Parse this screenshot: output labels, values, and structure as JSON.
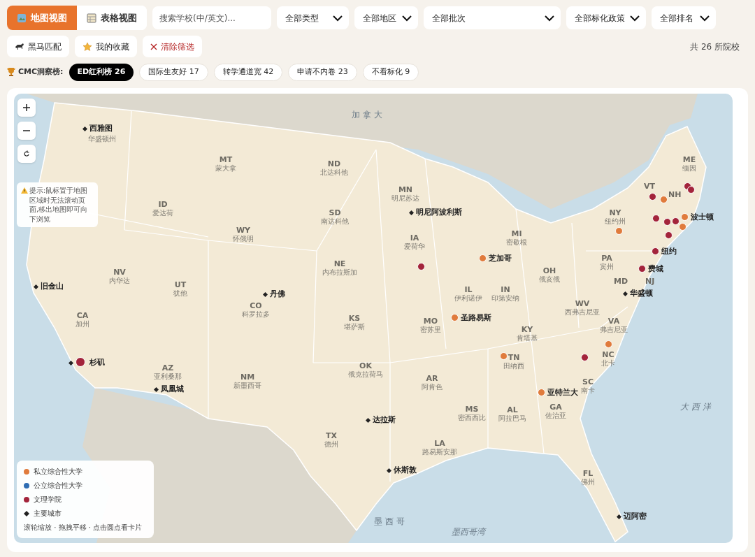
{
  "view_toggle": [
    {
      "label": "地图视图",
      "selected": true
    },
    {
      "label": "表格视图",
      "selected": false
    }
  ],
  "search": {
    "placeholder": "搜索学校(中/英文)..."
  },
  "filters": [
    "全部类型",
    "全部地区",
    "全部批次",
    "全部标化政策",
    "全部排名"
  ],
  "actions": [
    {
      "label": "黑马匹配",
      "kind": "horse"
    },
    {
      "label": "我的收藏",
      "kind": "star"
    },
    {
      "label": "清除筛选",
      "kind": "clear"
    }
  ],
  "result_count": "共 26 所院校",
  "ranking": {
    "label": "CMC洞察榜:",
    "chips": [
      {
        "label": "ED红利榜 26",
        "selected": true
      },
      {
        "label": "国际生友好 17",
        "selected": false
      },
      {
        "label": "转学通道宽 42",
        "selected": false
      },
      {
        "label": "申请不内卷 23",
        "selected": false
      },
      {
        "label": "不看标化 9",
        "selected": false
      }
    ]
  },
  "map": {
    "tip": "提示:鼠标置于地图区域时无法滚动页面,移出地图即可向下浏览",
    "regions": [
      "加 拿 大",
      "大 西 洋",
      "墨西哥湾",
      "墨 西 哥"
    ],
    "states": [
      {
        "name": "华盛顿州"
      },
      {
        "code": "MT",
        "name": "蒙大拿"
      },
      {
        "code": "ND",
        "name": "北达科他"
      },
      {
        "code": "SD",
        "name": "南达科他"
      },
      {
        "code": "ID",
        "name": "爱达荷"
      },
      {
        "code": "WY",
        "name": "怀俄明"
      },
      {
        "code": "NE",
        "name": "内布拉斯加"
      },
      {
        "code": "NV",
        "name": "内华达"
      },
      {
        "code": "UT",
        "name": "犹他"
      },
      {
        "code": "CO",
        "name": "科罗拉多"
      },
      {
        "code": "CA",
        "name": "加州"
      },
      {
        "code": "KS",
        "name": "堪萨斯"
      },
      {
        "code": "AZ",
        "name": "亚利桑那"
      },
      {
        "code": "NM",
        "name": "新墨西哥"
      },
      {
        "code": "OK",
        "name": "俄克拉荷马"
      },
      {
        "code": "TX",
        "name": "德州"
      },
      {
        "code": "MN",
        "name": "明尼苏达"
      },
      {
        "code": "IA",
        "name": "爱荷华"
      },
      {
        "code": "MI",
        "name": "密歇根"
      },
      {
        "code": "IL",
        "name": "伊利诺伊"
      },
      {
        "code": "IN",
        "name": "印第安纳"
      },
      {
        "code": "OH",
        "name": "俄亥俄"
      },
      {
        "code": "MO",
        "name": "密苏里"
      },
      {
        "code": "KY",
        "name": "肯塔基"
      },
      {
        "code": "TN",
        "name": "田纳西"
      },
      {
        "code": "AR",
        "name": "阿肯色"
      },
      {
        "code": "MS",
        "name": "密西西比"
      },
      {
        "code": "AL",
        "name": "阿拉巴马"
      },
      {
        "code": "GA",
        "name": "佐治亚"
      },
      {
        "code": "SC",
        "name": "南卡"
      },
      {
        "code": "VA",
        "name": "弗吉尼亚"
      },
      {
        "code": "NC",
        "name": "北卡"
      },
      {
        "code": "WV",
        "name": "西弗吉尼亚"
      },
      {
        "code": "PA",
        "name": "宾州"
      },
      {
        "code": "NY",
        "name": "纽约州"
      },
      {
        "code": "ME",
        "name": "缅因"
      },
      {
        "code": "VT"
      },
      {
        "code": "NH"
      },
      {
        "code": "MD"
      },
      {
        "code": "NJ"
      },
      {
        "code": "LA",
        "name": "路易斯安那"
      },
      {
        "code": "FL",
        "name": "佛州"
      }
    ],
    "cities": [
      "西雅图",
      "明尼阿波利斯",
      "旧金山",
      "丹佛",
      "杉矶",
      "凤凰城",
      "达拉斯",
      "休斯敦",
      "华盛顿",
      "迈阿密"
    ],
    "colleges": [
      {
        "color": "#a3243b"
      },
      {
        "color": "#a3243b"
      },
      {
        "color": "#e07b3c",
        "label": "芝加哥"
      },
      {
        "color": "#e07b3c",
        "label": "圣路易斯"
      },
      {
        "color": "#e07b3c"
      },
      {
        "color": "#e07b3c",
        "label": "亚特兰大"
      },
      {
        "color": "#e07b3c"
      },
      {
        "color": "#a3243b"
      },
      {
        "color": "#e07b3c"
      },
      {
        "color": "#a3243b"
      },
      {
        "color": "#e07b3c"
      },
      {
        "color": "#a3243b"
      },
      {
        "color": "#a3243b"
      },
      {
        "color": "#a3243b"
      },
      {
        "color": "#a3243b"
      },
      {
        "color": "#a3243b"
      },
      {
        "color": "#e07b3c",
        "label": "波士顿"
      },
      {
        "color": "#e07b3c"
      },
      {
        "color": "#a3243b"
      },
      {
        "color": "#a3243b",
        "label": "纽约"
      },
      {
        "color": "#a3243b",
        "label": "费城"
      }
    ],
    "legend": [
      {
        "label": "私立综合性大学",
        "kind": "dot",
        "color": "#e07b3c"
      },
      {
        "label": "公立综合性大学",
        "kind": "dot",
        "color": "#2f6db3"
      },
      {
        "label": "文理学院",
        "kind": "dot",
        "color": "#a3243b"
      },
      {
        "label": "主要城市",
        "kind": "diamond"
      }
    ],
    "hint": "滚轮缩放 · 拖拽平移 · 点击圆点看卡片"
  }
}
